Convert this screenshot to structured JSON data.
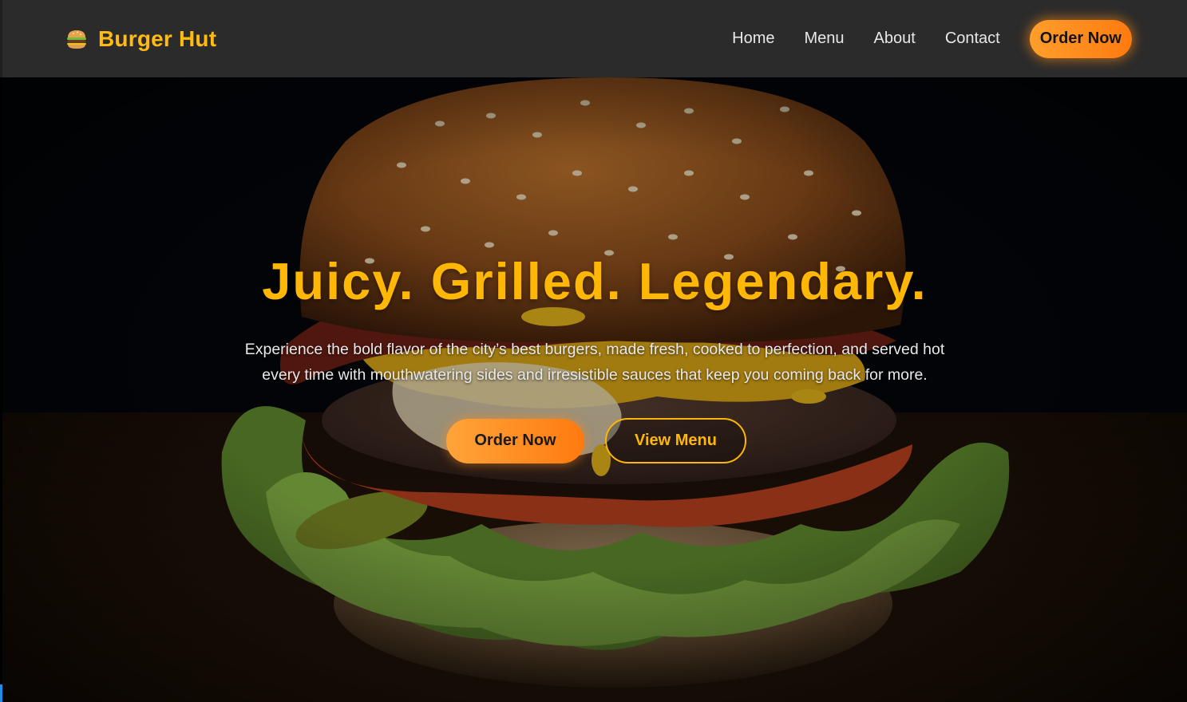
{
  "brand": {
    "icon": "burger-icon",
    "name": "Burger Hut"
  },
  "nav": {
    "links": [
      {
        "label": "Home"
      },
      {
        "label": "Menu"
      },
      {
        "label": "About"
      },
      {
        "label": "Contact"
      }
    ],
    "cta_label": "Order Now"
  },
  "hero": {
    "title": "Juicy. Grilled. Legendary.",
    "subtitle": "Experience the bold flavor of the city’s best burgers, made fresh, cooked to perfection, and served hot every time with mouthwatering sides and irresistible sauces that keep you coming back for more.",
    "primary_label": "Order Now",
    "secondary_label": "View Menu",
    "background_image": "burger-photo"
  },
  "colors": {
    "accent": "#ffb705",
    "cta_gradient_start": "#ffa43a",
    "cta_gradient_end": "#ff7a0f",
    "header_bg": "#2b2b2b"
  }
}
